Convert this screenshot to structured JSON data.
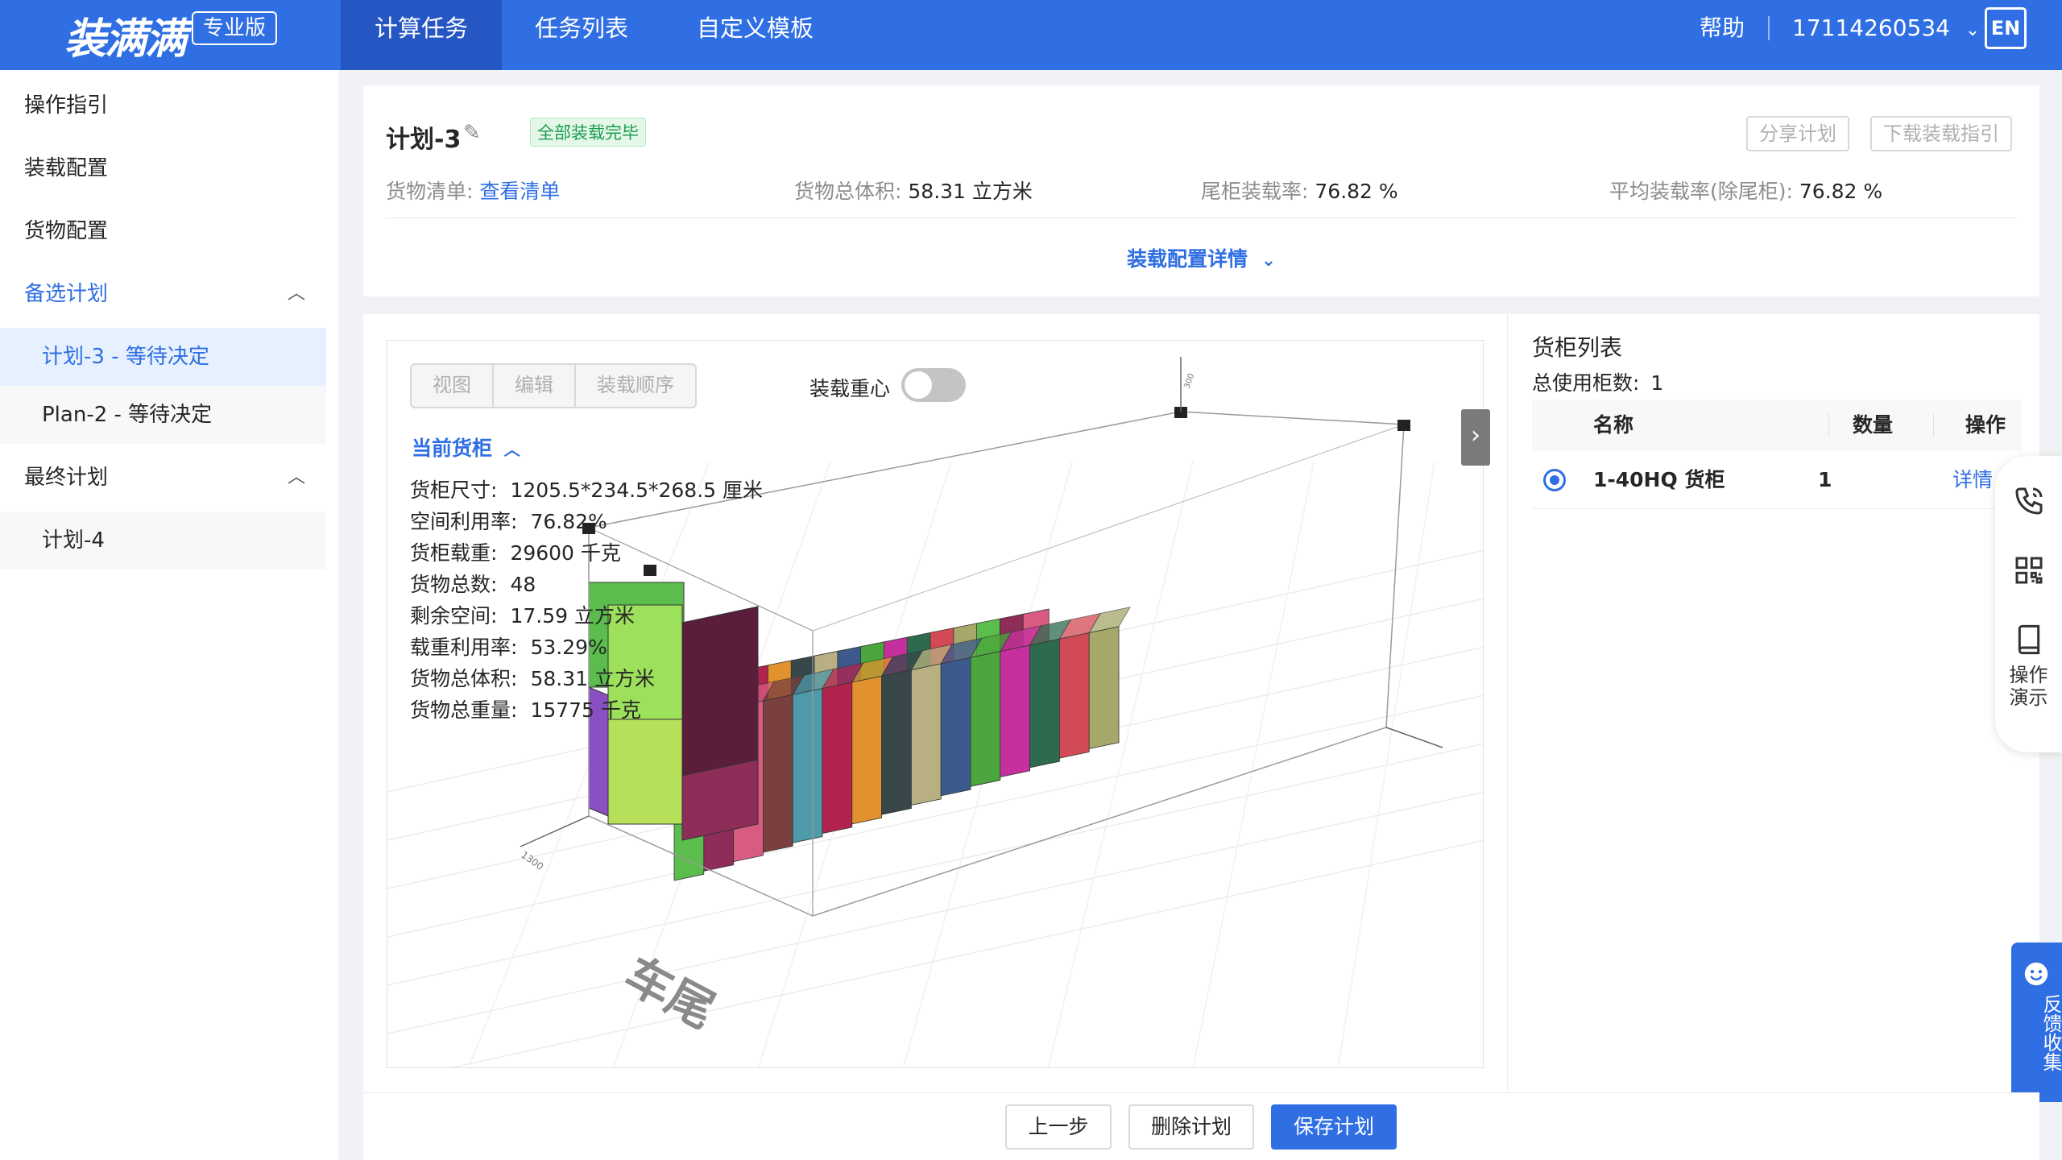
{
  "header": {
    "logo": "装满满",
    "edition_badge": "专业版",
    "tabs": [
      {
        "label": "计算任务",
        "active": true
      },
      {
        "label": "任务列表",
        "active": false
      },
      {
        "label": "自定义模板",
        "active": false
      }
    ],
    "help": "帮助",
    "account": "17114260534",
    "lang": "EN"
  },
  "sidebar": {
    "items": [
      {
        "label": "操作指引"
      },
      {
        "label": "装载配置"
      },
      {
        "label": "货物配置"
      },
      {
        "label": "备选计划"
      },
      {
        "label": "计划-3 - 等待决定"
      },
      {
        "label": "Plan-2 - 等待决定"
      },
      {
        "label": "最终计划"
      },
      {
        "label": "计划-4"
      }
    ]
  },
  "summary": {
    "plan_name": "计划-3",
    "status": "全部装载完毕",
    "share_button": "分享计划",
    "download_button": "下载装载指引",
    "cargo_list_label": "货物清单:",
    "cargo_list_link": "查看清单",
    "total_volume_label": "货物总体积:",
    "total_volume": "58.31 立方米",
    "tail_rate_label": "尾柜装载率:",
    "tail_rate": "76.82 %",
    "avg_rate_label": "平均装载率(除尾柜):",
    "avg_rate": "76.82 %",
    "config_detail": "装载配置详情"
  },
  "viewer": {
    "modes": [
      "视图",
      "编辑",
      "装载顺序"
    ],
    "cog_label": "装载重心",
    "cog_enabled": false,
    "current_container": "当前货柜",
    "info": [
      {
        "label": "货柜尺寸:",
        "value": "1205.5*234.5*268.5 厘米"
      },
      {
        "label": "空间利用率:",
        "value": "76.82%"
      },
      {
        "label": "货柜载重:",
        "value": "29600 千克"
      },
      {
        "label": "货物总数:",
        "value": "48"
      },
      {
        "label": "剩余空间:",
        "value": "17.59 立方米"
      },
      {
        "label": "载重利用率:",
        "value": "53.29%"
      },
      {
        "label": "货物总体积:",
        "value": "58.31 立方米"
      },
      {
        "label": "货物总重量:",
        "value": "15775 千克"
      }
    ],
    "tail_label": "车尾",
    "axis_labels": [
      "300",
      "1300"
    ]
  },
  "container_list": {
    "title": "货柜列表",
    "total_label": "总使用柜数:",
    "total": "1",
    "columns": [
      "名称",
      "数量",
      "操作"
    ],
    "rows": [
      {
        "name": "1-40HQ 货柜",
        "qty": "1",
        "action": "详情",
        "selected": true
      }
    ]
  },
  "float_tools": {
    "demo_label": "操作演示",
    "feedback": "反馈收集"
  },
  "footer": {
    "prev": "上一步",
    "delete": "删除计划",
    "save": "保存计划"
  },
  "colors": {
    "brand": "#2f6fe3",
    "brand_dark": "#2556c4",
    "success": "#1a9d4c"
  }
}
